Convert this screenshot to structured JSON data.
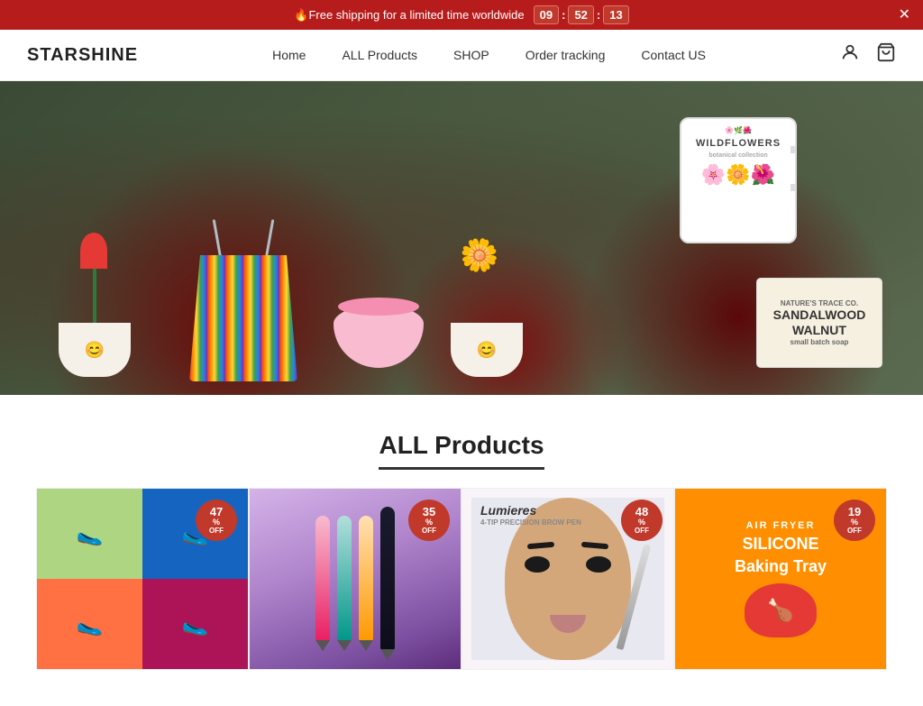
{
  "announcement": {
    "text": "🔥Free shipping for a limited time worldwide",
    "timer": {
      "hours": "09",
      "minutes": "52",
      "seconds": "13"
    },
    "bg_color": "#b71c1c"
  },
  "header": {
    "logo": "STARSHINE",
    "nav": [
      {
        "id": "home",
        "label": "Home"
      },
      {
        "id": "all-products",
        "label": "ALL Products"
      },
      {
        "id": "shop",
        "label": "SHOP"
      },
      {
        "id": "order-tracking",
        "label": "Order tracking"
      },
      {
        "id": "contact-us",
        "label": "Contact US"
      }
    ]
  },
  "hero": {
    "alt": "Hero banner with various products including flower pots, tote bag, mug, soap",
    "mug_text": "WILDFLOWERS",
    "soap_brand": "NATURE'S TRACE CO.",
    "soap_name": "SANDALWOOD WALNUT",
    "soap_sub": "small batch soap"
  },
  "section": {
    "title": "ALL Products"
  },
  "products": [
    {
      "id": "shoes",
      "discount": "47",
      "label": "Colorful Water Shoes"
    },
    {
      "id": "eyeliner",
      "discount": "35",
      "label": "Precision Eyeliner Set"
    },
    {
      "id": "eyebrow",
      "discount": "48",
      "label": "4-Tip Precision Brow Pen"
    },
    {
      "id": "airfryer",
      "discount": "19",
      "label": "Air Fryer Silicone Baking Tray",
      "tag1": "AIR FRYER",
      "tag2": "SILICONE",
      "tag3": "Baking Tray"
    }
  ]
}
